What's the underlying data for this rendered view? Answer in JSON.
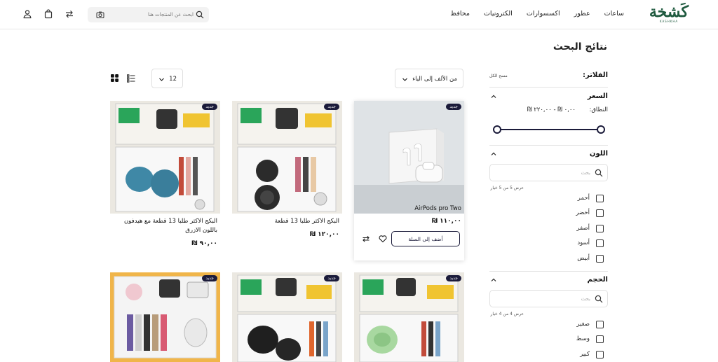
{
  "brand": {
    "logo_text": "كَشخة",
    "logo_sub": "KASHKHA"
  },
  "nav": [
    "ساعات",
    "عطور",
    "اكسسوارات",
    "الكترونيات",
    "محافظ"
  ],
  "search": {
    "placeholder": "ابحث عن المنتجات هنا"
  },
  "page_title": "نتائج البحث",
  "filters": {
    "title": "الفلاتر:",
    "clear_all": "مسح الكل",
    "price": {
      "title": "السعر",
      "range_label": "النطاق:",
      "range_value": "٠,٠٠ ₪ - ٢٢٠,٠٠ ₪",
      "min_fraction": 0.0,
      "max_fraction": 1.0
    },
    "color": {
      "title": "اللون",
      "search_placeholder": "بحث",
      "count_text": "عرض 5 من 5 خيار",
      "options": [
        "أحمر",
        "أخضر",
        "أصفر",
        "أسود",
        "أبيض"
      ]
    },
    "size": {
      "title": "الحجم",
      "search_placeholder": "بحث",
      "count_text": "عرض 4 من 4 خيار",
      "options": [
        "صغير",
        "وسط",
        "كبير"
      ]
    }
  },
  "toolbar": {
    "sort_value": "من الألف إلى الياء",
    "per_page": "12"
  },
  "products": [
    {
      "name": "AirPods pro Two",
      "price": "١١٠,٠٠ ₪",
      "badge": "جديد",
      "add_to_cart": "أضف إلى السلة"
    },
    {
      "name": "البكج الاكثر طلبا 13 قطعة",
      "price": "١٢٠,٠٠ ₪",
      "badge": "جديد"
    },
    {
      "name": "البكج الاكثر طلبا 13 قطعة مع هيدفون باللون الازرق",
      "price": "٩٠,٠٠ ₪",
      "badge": "جديد"
    },
    {
      "badge": "جديد"
    },
    {
      "badge": "جديد"
    },
    {
      "badge": "جديد"
    }
  ],
  "colors": {
    "primary": "#1b1b3a",
    "brand_green": "#1f5a3f"
  }
}
